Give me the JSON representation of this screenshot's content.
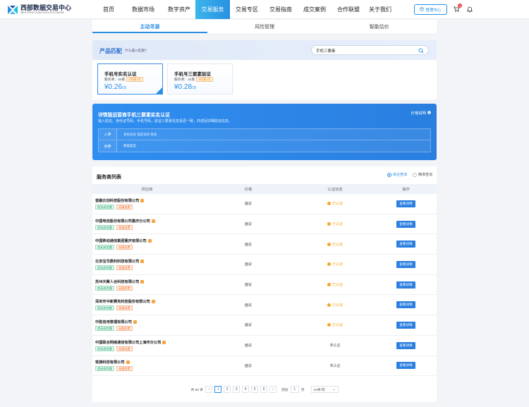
{
  "header": {
    "logo_cn": "西部数据交易中心",
    "logo_en": "WESTERN CHINA DATA EXCHANGE",
    "nav": [
      {
        "label": "首页",
        "width": 42
      },
      {
        "label": "数据市场",
        "width": 56
      },
      {
        "label": "数字资产",
        "width": 46
      },
      {
        "label": "交易服务",
        "width": 49,
        "active": true
      },
      {
        "label": "交易专区",
        "width": 48
      },
      {
        "label": "交易指南",
        "width": 48
      },
      {
        "label": "成交案例",
        "width": 48
      },
      {
        "label": "合作联盟",
        "width": 48
      },
      {
        "label": "关于我们",
        "width": 42
      }
    ],
    "manage_label": "管理中心",
    "cart_count": "1"
  },
  "tabs": [
    "主动寻源",
    "风险管理",
    "智能估价"
  ],
  "product_match": {
    "title": "产品匹配",
    "hint": "什么是AI匹配?",
    "search_value": "手机三要素",
    "cards": [
      {
        "title": "手机号实名认证",
        "vendors": "服务商：60家",
        "tag": "3项满1项",
        "price": "¥0.26",
        "unit": "/次"
      },
      {
        "title": "手机号三要素验证",
        "vendors": "服务商：32家",
        "tag": "3项满1项",
        "price": "¥0.28",
        "unit": "/次"
      }
    ]
  },
  "detail": {
    "title": "详情版运营商手机三要素实名认证",
    "desc": "输入姓名、身份证号码、手机号码，验证三要素信息是否一致，并返回详细验证信息。",
    "link": "价格说明",
    "input_key": "入参",
    "input_val": "身份证号  电话号码  姓名",
    "output_key": "出参",
    "output_val": "数据类型"
  },
  "provider_list": {
    "title": "服务商列表",
    "radio_1": "综合查询",
    "radio_2": "精准查询",
    "columns": [
      "供应商",
      "价格",
      "认证状态",
      "操作"
    ],
    "rows": [
      {
        "name": "首融云创科技股份有限公司",
        "tag1": "首无成交量",
        "tag2": "无服务费",
        "price": "面议",
        "status": "已认证",
        "action": "查看详情"
      },
      {
        "name": "中国电信股份有限公司重庆分公司",
        "tag1": "首无成交量",
        "tag2": "无服务费",
        "price": "面议",
        "status": "已认证",
        "action": "查看详情"
      },
      {
        "name": "中国移动通信集团重庆有限公司",
        "tag1": "首无成交量",
        "tag2": "无服务费",
        "price": "面议",
        "status": "已认证",
        "action": "查看详情"
      },
      {
        "name": "北京宝华鼎利科技有限公司",
        "tag1": "首无成交量",
        "tag2": "无服务费",
        "price": "面议",
        "status": "已认证",
        "action": "查看详情"
      },
      {
        "name": "苏州天聚人合科技有限公司",
        "tag1": "首无成交量",
        "tag2": "无服务费",
        "price": "面议",
        "status": "已认证",
        "action": "查看详情"
      },
      {
        "name": "深圳市中新赛克科技股份有限公司",
        "tag1": "首无成交量",
        "tag2": "无服务费",
        "price": "面议",
        "status": "已认证",
        "action": "查看详情"
      },
      {
        "name": "中胜信用管理有限公司",
        "tag1": "首无成交量",
        "tag2": "无服务费",
        "price": "面议",
        "status": "已认证",
        "action": "查看详情"
      },
      {
        "name": "中国联合网络通信有限公司上海市分公司",
        "tag1": "首无成交量",
        "tag2": "无服务费",
        "price": "面议",
        "status": "未认证",
        "action": "查看详情"
      },
      {
        "name": "铁旗科技有限公司",
        "tag1": "首无成交量",
        "tag2": "无服务费",
        "price": "面议",
        "status": "未认证",
        "action": "查看详情"
      }
    ]
  },
  "pagination": {
    "total": "共 60 条",
    "pages": [
      "1",
      "2",
      "3",
      "4",
      "5",
      "6"
    ],
    "current": "1",
    "goto_label": "前往",
    "goto_value": "1",
    "page_label": "页",
    "page_size": "10条/页"
  },
  "colors": {
    "accent": "#2a8fe3",
    "verified": "#f5a623",
    "tag_green": "#1aa06b",
    "tag_orange": "#f26a2a"
  }
}
